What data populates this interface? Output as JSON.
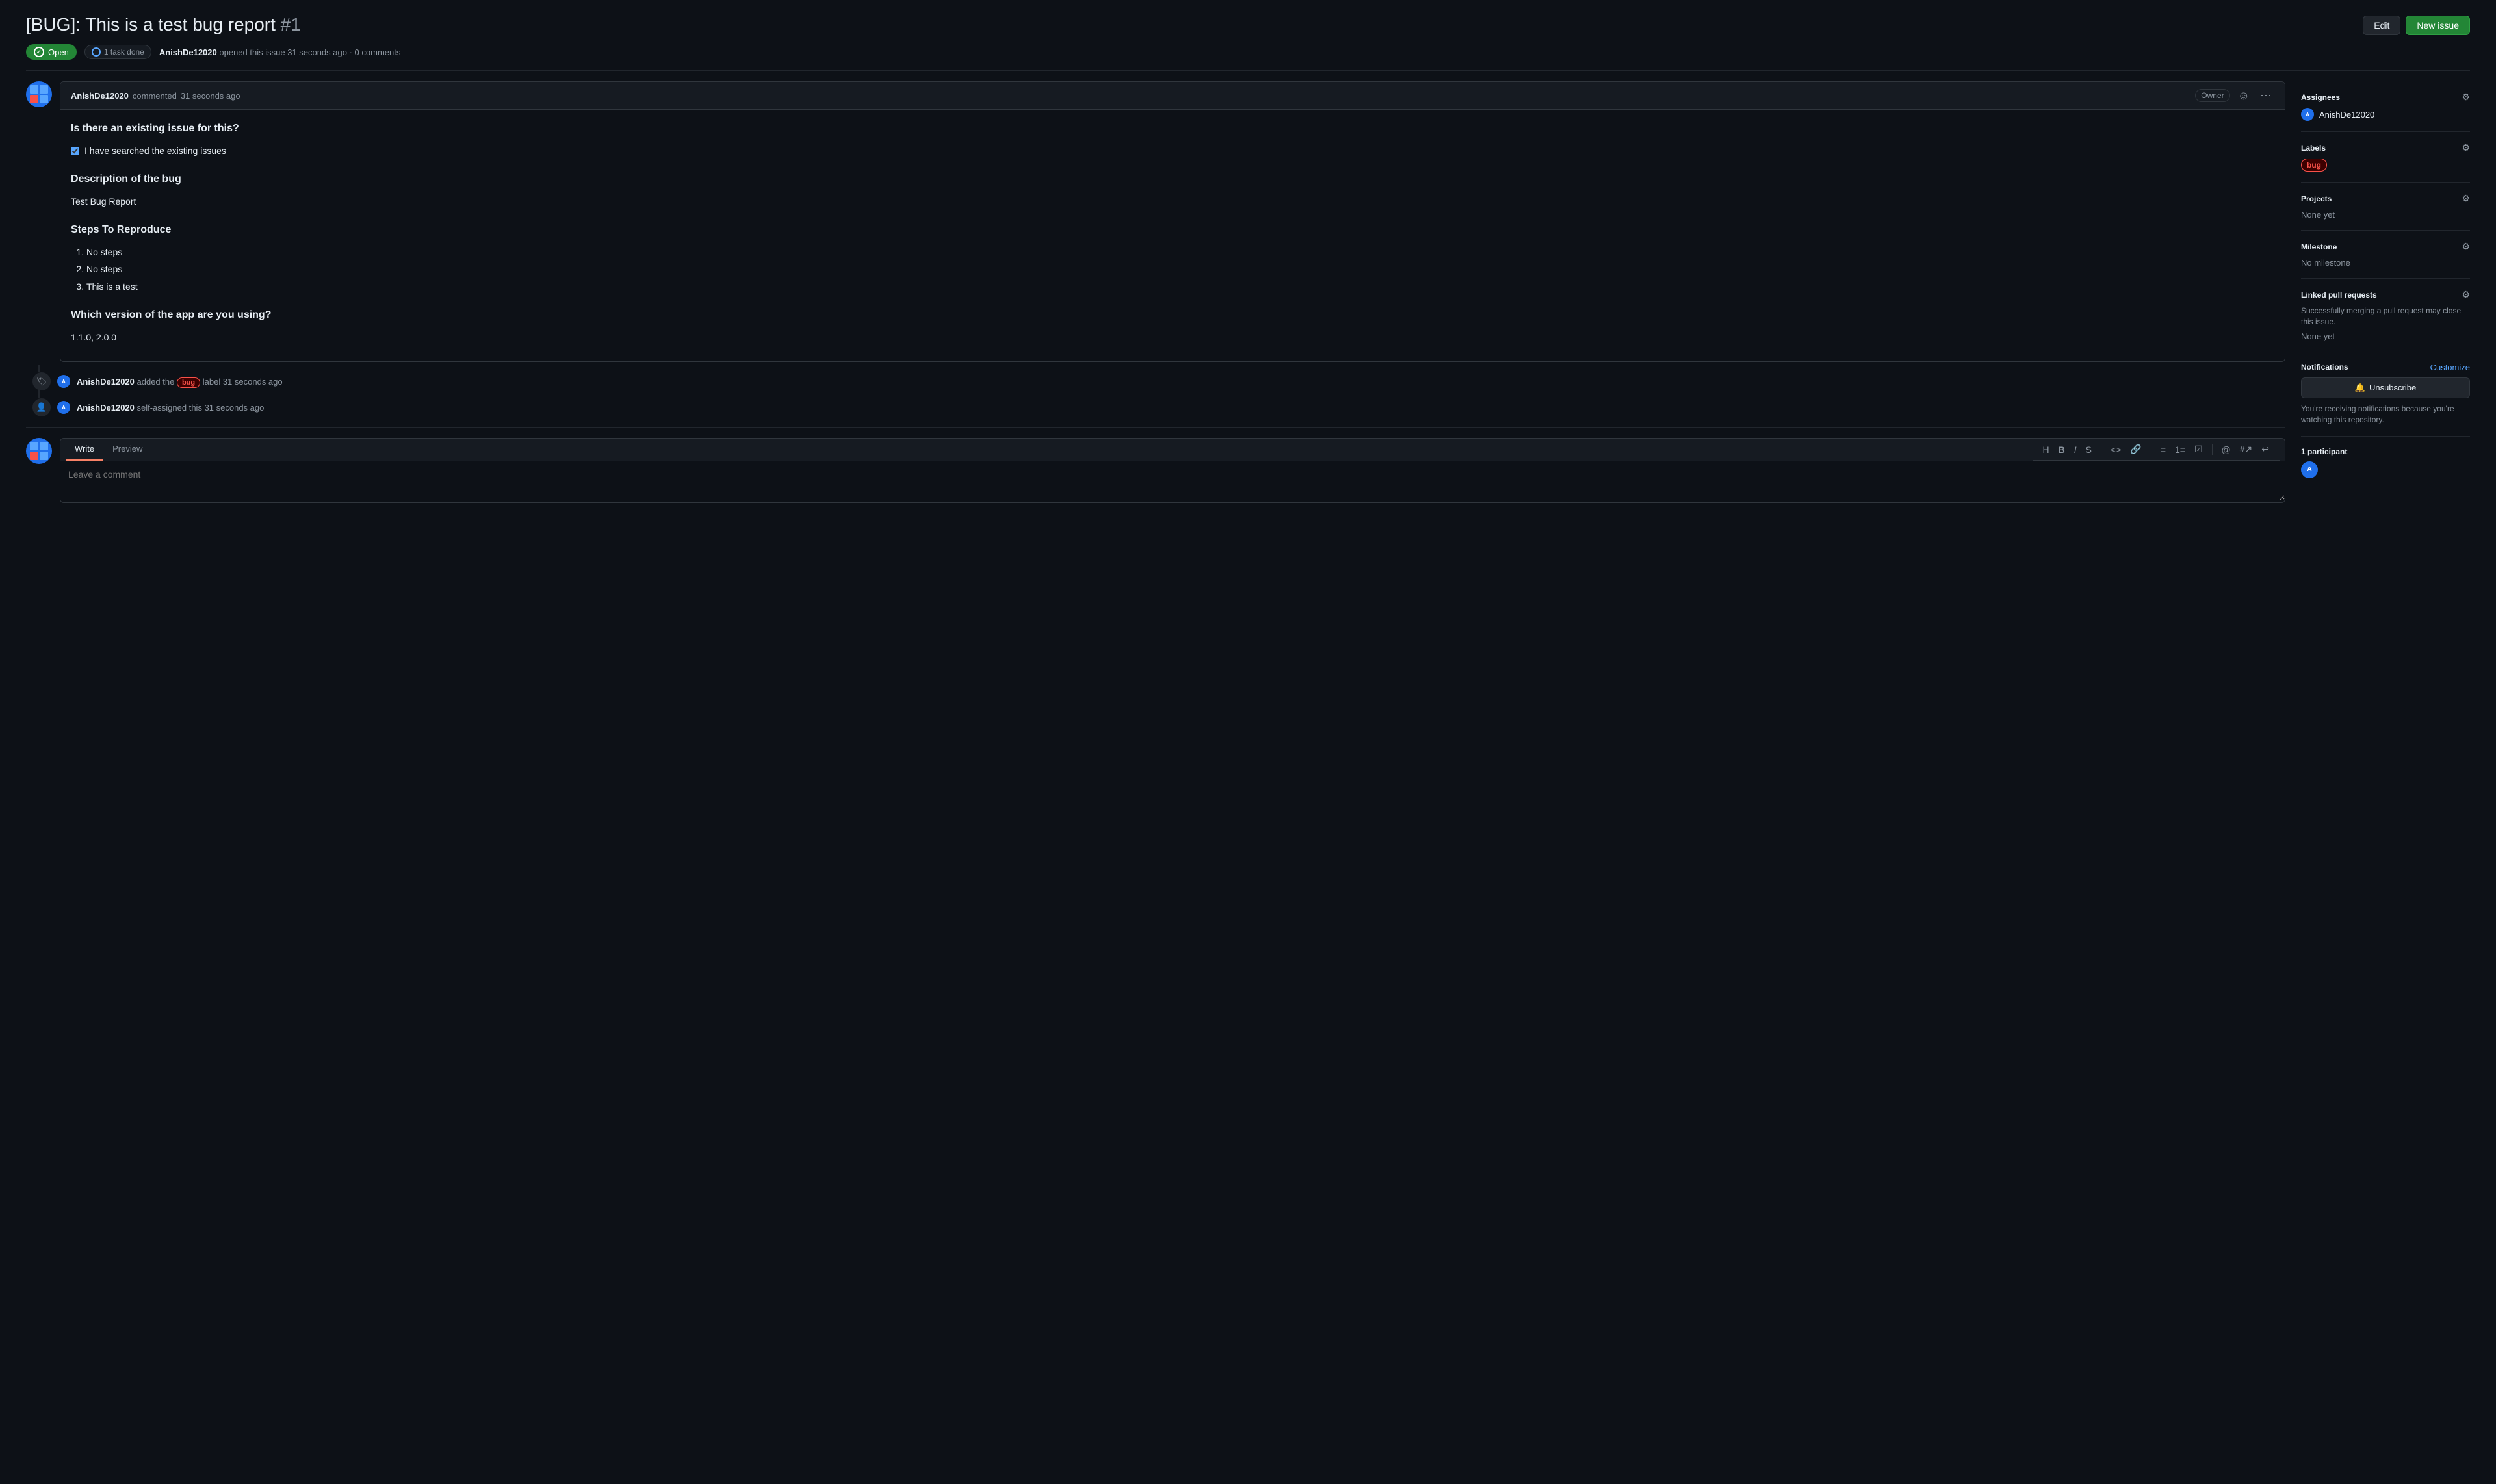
{
  "header": {
    "title": "[BUG]: This is a test bug report",
    "issue_number": "#1",
    "edit_label": "Edit",
    "new_issue_label": "New issue"
  },
  "status": {
    "open_label": "Open",
    "task_done_label": "1 task done",
    "author": "AnishDe12020",
    "action": "opened this issue",
    "time": "31 seconds ago",
    "comments": "0 comments"
  },
  "comment": {
    "author": "AnishDe12020",
    "action": "commented",
    "time": "31 seconds ago",
    "owner_label": "Owner",
    "section1_title": "Is there an existing issue for this?",
    "checkbox_label": "I have searched the existing issues",
    "section2_title": "Description of the bug",
    "description": "Test Bug Report",
    "section3_title": "Steps To Reproduce",
    "steps": [
      "No steps",
      "No steps",
      "This is a test"
    ],
    "section4_title": "Which version of the app are you using?",
    "version": "1.1.0, 2.0.0"
  },
  "timeline": [
    {
      "author": "AnishDe12020",
      "action": "added the",
      "label": "bug",
      "action2": "label",
      "time": "31 seconds ago"
    },
    {
      "author": "AnishDe12020",
      "action": "self-assigned this",
      "time": "31 seconds ago"
    }
  ],
  "write_tab": {
    "write_label": "Write",
    "preview_label": "Preview",
    "placeholder": "Leave a comment"
  },
  "sidebar": {
    "assignees_title": "Assignees",
    "assignee_name": "AnishDe12020",
    "labels_title": "Labels",
    "label_bug": "bug",
    "projects_title": "Projects",
    "projects_none": "None yet",
    "milestone_title": "Milestone",
    "milestone_none": "No milestone",
    "linked_pr_title": "Linked pull requests",
    "linked_pr_note": "Successfully merging a pull request may close this issue.",
    "linked_pr_none": "None yet",
    "notifications_title": "Notifications",
    "customize_label": "Customize",
    "unsubscribe_label": "Unsubscribe",
    "notification_note": "You're receiving notifications because you're watching this repository.",
    "participants_title": "1 participant"
  },
  "colors": {
    "accent_green": "#238636",
    "accent_blue": "#58a6ff",
    "accent_red": "#f85149",
    "bg_dark": "#0d1117",
    "bg_card": "#161b22",
    "border": "#30363d"
  }
}
